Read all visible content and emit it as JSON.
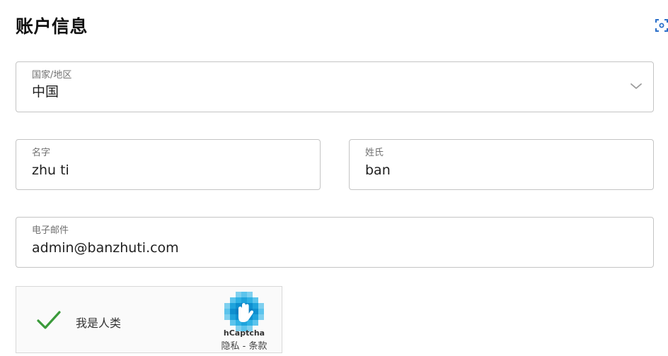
{
  "header": {
    "title": "账户信息"
  },
  "form": {
    "country": {
      "label": "国家/地区",
      "value": "中国"
    },
    "first_name": {
      "label": "名字",
      "value": "zhu ti"
    },
    "last_name": {
      "label": "姓氏",
      "value": "ban"
    },
    "email": {
      "label": "电子邮件",
      "value": "admin@banzhuti.com"
    }
  },
  "captcha": {
    "status_text": "我是人类",
    "brand": "hCaptcha",
    "privacy_label": "隐私",
    "separator": " - ",
    "terms_label": "条款",
    "checked": true
  },
  "colors": {
    "check": "#3a9a3a",
    "border": "#c4c4c4",
    "captcha_logo": "#1f9fd6",
    "scan_icon": "#2a6fc9"
  },
  "icons": {
    "scan": "scan-icon",
    "dropdown": "chevron-down-icon",
    "check": "checkmark-icon",
    "captcha_logo": "hcaptcha-logo-icon"
  }
}
